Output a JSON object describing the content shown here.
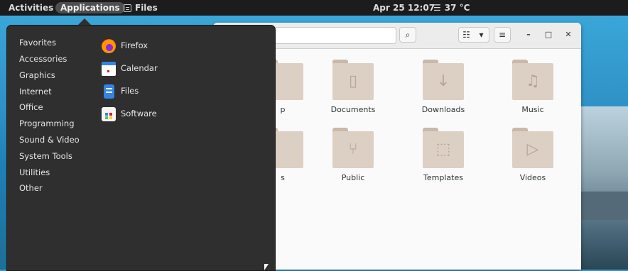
{
  "top_bar": {
    "activities": "Activities",
    "applications": "Applications",
    "files_app": "Files",
    "clock": "Apr 25  12:07",
    "weather": "37 °C",
    "weather_icon": "fog-icon"
  },
  "app_menu": {
    "categories": [
      "Favorites",
      "Accessories",
      "Graphics",
      "Internet",
      "Office",
      "Programming",
      "Sound & Video",
      "System Tools",
      "Utilities",
      "Other"
    ],
    "apps": [
      {
        "label": "Firefox",
        "icon": "firefox-icon"
      },
      {
        "label": "Calendar",
        "icon": "calendar-icon"
      },
      {
        "label": "Files",
        "icon": "files-icon"
      },
      {
        "label": "Software",
        "icon": "software-icon"
      }
    ]
  },
  "files_window": {
    "folders_row1": [
      {
        "label": "p",
        "icon": "desktop-folder-icon"
      },
      {
        "label": "Documents",
        "icon": "documents-folder-icon"
      },
      {
        "label": "Downloads",
        "icon": "downloads-folder-icon"
      },
      {
        "label": "Music",
        "icon": "music-folder-icon"
      }
    ],
    "folders_row2": [
      {
        "label": "s",
        "icon": "pictures-folder-icon"
      },
      {
        "label": "Public",
        "icon": "public-folder-icon"
      },
      {
        "label": "Templates",
        "icon": "templates-folder-icon"
      },
      {
        "label": "Videos",
        "icon": "videos-folder-icon"
      }
    ]
  },
  "colors": {
    "top_bar": "#1c1c1c",
    "menu_bg": "#2f2f2f",
    "folder": "#dcd0c4",
    "accent": "#3584e4"
  }
}
